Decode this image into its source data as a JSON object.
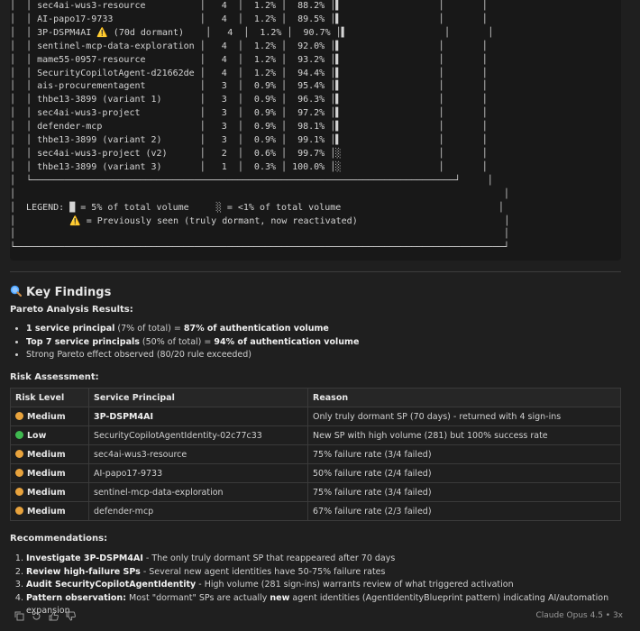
{
  "ascii_block": [
    "│  │ sec4ai-wus3-resource          │   4  │  1.2% │  88.2% │▌                  │       │",
    "│  │ AI-papo17-9733                │   4  │  1.2% │  89.5% │▌                  │       │",
    "│  │ 3P-DSPM4AI ⚠️ (70d dormant)    │   4  │  1.2% │  90.7% │▌                  │       │",
    "│  │ sentinel-mcp-data-exploration │   4  │  1.2% │  92.0% │▌                  │       │",
    "│  │ mame55-0957-resource          │   4  │  1.2% │  93.2% │▌                  │       │",
    "│  │ SecurityCopilotAgent-d21662de │   4  │  1.2% │  94.4% │▌                  │       │",
    "│  │ ais-procurementagent          │   3  │  0.9% │  95.4% │▌                  │       │",
    "│  │ thbe13-3899 (variant 1)       │   3  │  0.9% │  96.3% │▌                  │       │",
    "│  │ sec4ai-wus3-project           │   3  │  0.9% │  97.2% │▌                  │       │",
    "│  │ defender-mcp                  │   3  │  0.9% │  98.1% │▌                  │       │",
    "│  │ thbe13-3899 (variant 2)       │   3  │  0.9% │  99.1% │▌                  │       │",
    "│  │ sec4ai-wus3-project (v2)      │   2  │  0.6% │  99.7% │░                  │       │",
    "│  │ thbe13-3899 (variant 3)       │   1  │  0.3% │ 100.0% │░                  │       │",
    "│  └──────────────────────────────────────────────────────────────────────────────┘     │",
    "│                                                                                          │",
    "│  LEGEND: █ = 5% of total volume     ░ = <1% of total volume                             │",
    "│          ⚠️ = Previously seen (truly dormant, now reactivated)                           │",
    "│                                                                                          │",
    "└──────────────────────────────────────────────────────────────────────────────────────────┘"
  ],
  "key_findings": {
    "icon": "magnifier-icon",
    "title": "Key Findings",
    "pareto_heading": "Pareto Analysis Results:",
    "pareto_bullets": [
      {
        "bold": "1 service principal",
        "mid": " (7% of total) = ",
        "bold2": "87% of authentication volume"
      },
      {
        "bold": "Top 7 service principals",
        "mid": " (50% of total) = ",
        "bold2": "94% of authentication volume"
      },
      {
        "bold": "",
        "mid": "Strong Pareto effect observed (80/20 rule exceeded)",
        "bold2": ""
      }
    ],
    "risk_heading": "Risk Assessment:"
  },
  "risk_table": {
    "headers": [
      "Risk Level",
      "Service Principal",
      "Reason"
    ],
    "rows": [
      {
        "level": "Medium",
        "color": "#e8a33d",
        "principal": "3P-DSPM4AI",
        "principal_bold": true,
        "reason": "Only truly dormant SP (70 days) - returned with 4 sign-ins"
      },
      {
        "level": "Low",
        "color": "#3fb950",
        "principal": "SecurityCopilotAgentIdentity-02c77c33",
        "principal_bold": false,
        "reason": "New SP with high volume (281) but 100% success rate"
      },
      {
        "level": "Medium",
        "color": "#e8a33d",
        "principal": "sec4ai-wus3-resource",
        "principal_bold": false,
        "reason": "75% failure rate (3/4 failed)"
      },
      {
        "level": "Medium",
        "color": "#e8a33d",
        "principal": "AI-papo17-9733",
        "principal_bold": false,
        "reason": "50% failure rate (2/4 failed)"
      },
      {
        "level": "Medium",
        "color": "#e8a33d",
        "principal": "sentinel-mcp-data-exploration",
        "principal_bold": false,
        "reason": "75% failure rate (3/4 failed)"
      },
      {
        "level": "Medium",
        "color": "#e8a33d",
        "principal": "defender-mcp",
        "principal_bold": false,
        "reason": "67% failure rate (2/3 failed)"
      }
    ]
  },
  "recommendations": {
    "heading": "Recommendations:",
    "items": [
      {
        "bold": "Investigate 3P-DSPM4AI",
        "rest": " - The only truly dormant SP that reappeared after 70 days"
      },
      {
        "bold": "Review high-failure SPs",
        "rest": " - Several new agent identities have 50-75% failure rates"
      },
      {
        "bold": "Audit SecurityCopilotAgentIdentity",
        "rest": " - High volume (281 sign-ins) warrants review of what triggered activation"
      },
      {
        "bold": "Pattern observation:",
        "rest": " Most \"dormant\" SPs are actually ",
        "bold2": "new",
        "rest2": " agent identities (AgentIdentityBlueprint pattern) indicating AI/automation expansion"
      }
    ]
  },
  "footer": {
    "model_label": "Claude Opus 4.5 • 3x",
    "icons": [
      "copy-icon",
      "retry-icon",
      "thumbs-up-icon",
      "thumbs-down-icon"
    ]
  }
}
